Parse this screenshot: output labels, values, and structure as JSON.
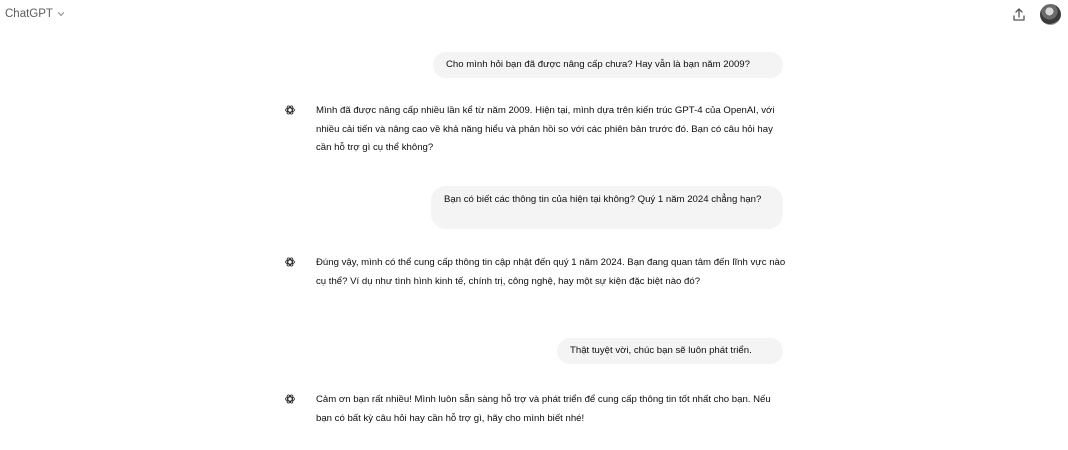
{
  "header": {
    "model_label": "ChatGPT",
    "share_icon": "share-icon",
    "avatar": "user-avatar"
  },
  "conversation": [
    {
      "role": "user",
      "text": "Cho mình hỏi bạn đã được nâng cấp chưa? Hay vẫn là bạn năm 2009?"
    },
    {
      "role": "assistant",
      "text": "Mình đã được nâng cấp nhiều lần kể từ năm 2009. Hiện tại, mình dựa trên kiến trúc GPT-4 của OpenAI, với nhiều cải tiến và nâng cao về khả năng hiểu và phản hồi so với các phiên bản trước đó. Bạn có câu hỏi hay cần hỗ trợ gì cụ thể không?"
    },
    {
      "role": "user",
      "text": "Bạn có biết các thông tin của hiện tại không? Quý 1 năm 2024 chẳng hạn?"
    },
    {
      "role": "assistant",
      "text": "Đúng vậy, mình có thể cung cấp thông tin cập nhật đến quý 1 năm 2024. Bạn đang quan tâm đến lĩnh vực nào cụ thể? Ví dụ như tình hình kinh tế, chính trị, công nghệ, hay một sự kiện đặc biệt nào đó?"
    },
    {
      "role": "user",
      "text": "Thật tuyệt vời, chúc bạn sẽ luôn phát triển."
    },
    {
      "role": "assistant",
      "text": "Cảm ơn bạn rất nhiều! Mình luôn sẵn sàng hỗ trợ và phát triển để cung cấp thông tin tốt nhất cho bạn. Nếu bạn có bất kỳ câu hỏi hay cần hỗ trợ gì, hãy cho mình biết nhé!"
    }
  ]
}
